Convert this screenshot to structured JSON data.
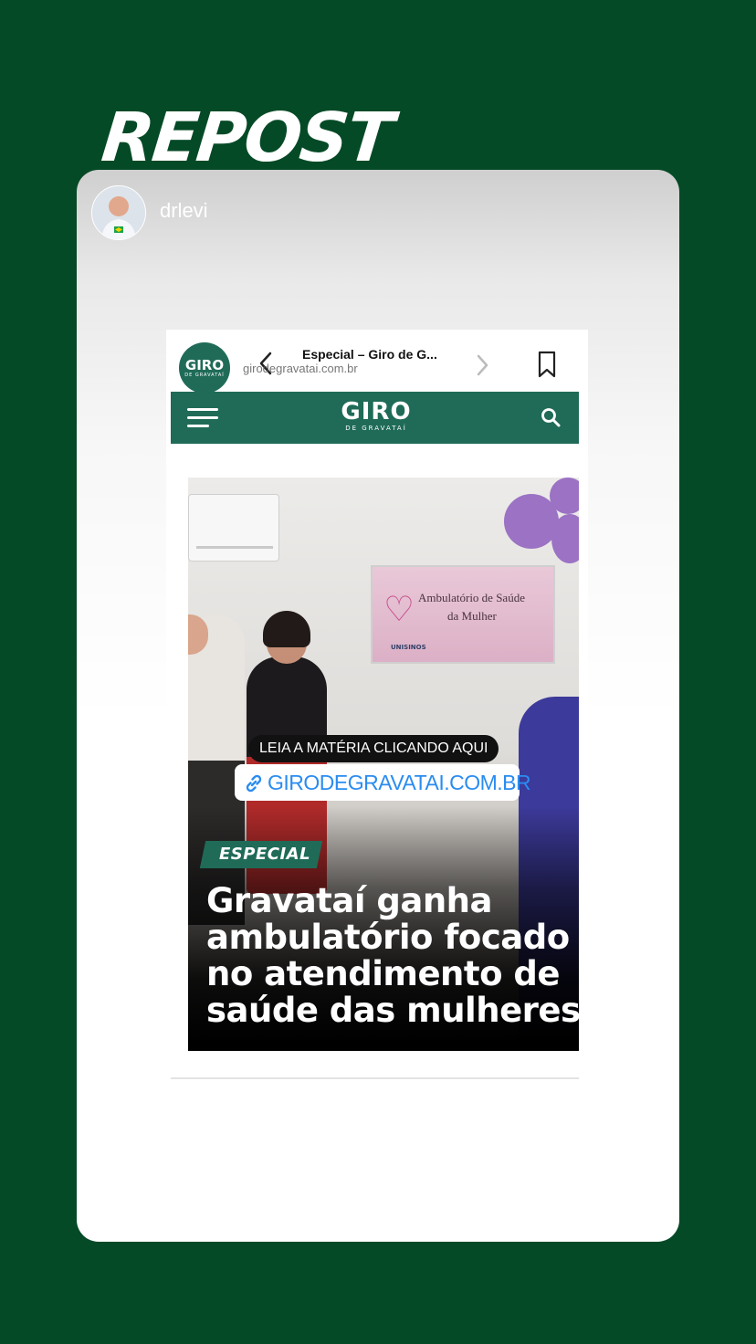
{
  "story": {
    "banner": "REPOST",
    "username": "drlevi",
    "colors": {
      "background": "#054a26",
      "brand_green": "#1f6b58",
      "link_blue": "#2a8cf0"
    }
  },
  "browser": {
    "page_title": "Especial – Giro de G...",
    "url": "girodegravatai.com.br",
    "badge_text": "GIRO",
    "badge_sub": "DE GRAVATAÍ",
    "icons": [
      "back-icon",
      "forward-icon",
      "bookmark-icon"
    ]
  },
  "site": {
    "brand": "GIRO",
    "brand_sub": "DE GRAVATAÍ",
    "icons": [
      "menu-icon",
      "search-icon"
    ]
  },
  "post": {
    "plaque_line1": "Ambulatório de Saúde",
    "plaque_line2": "da Mulher",
    "plaque_logos": "UNISINOS",
    "cta": "LEIA A MATÉRIA CLICANDO AQUI",
    "link": "GIRODEGRAVATAI.COM.BR",
    "tag": "ESPECIAL",
    "headline": [
      "Gravataí ganha",
      "ambulatório focado",
      "no atendimento de",
      "saúde das mulheres"
    ]
  }
}
